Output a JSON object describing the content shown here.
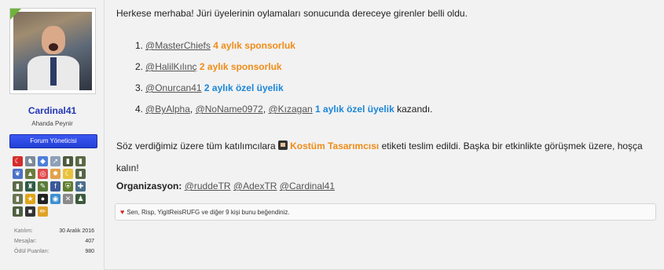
{
  "sidebar": {
    "username": "Cardinal41",
    "user_title": "Ahanda Peynir",
    "role_banner": "Forum Yöneticisi",
    "trophies": [
      {
        "icon": "flag-icon",
        "glyph": "☾",
        "color": "#d52b2b"
      },
      {
        "icon": "trophy-scene-icon",
        "glyph": "♞",
        "color": "#7c8a99"
      },
      {
        "icon": "pill-icon",
        "glyph": "◆",
        "color": "#4f7fd9"
      },
      {
        "icon": "rocket-icon",
        "glyph": "➚",
        "color": "#8da0b8"
      },
      {
        "icon": "rank-badge-icon",
        "glyph": "▮",
        "color": "#4e5a3c"
      },
      {
        "icon": "rank-badge-icon",
        "glyph": "▮",
        "color": "#5a6a44"
      },
      {
        "icon": "laurel-icon",
        "glyph": "❦",
        "color": "#4b72c8"
      },
      {
        "icon": "tank-icon",
        "glyph": "▲",
        "color": "#6b7b3f"
      },
      {
        "icon": "target-icon",
        "glyph": "◎",
        "color": "#e14b4b"
      },
      {
        "icon": "gear-icon",
        "glyph": "✹",
        "color": "#e2a14a"
      },
      {
        "icon": "moon-icon",
        "glyph": "☾",
        "color": "#e8c23a"
      },
      {
        "icon": "rank-badge-icon",
        "glyph": "▮",
        "color": "#556545"
      },
      {
        "icon": "rank-badge-icon",
        "glyph": "▮",
        "color": "#5b6a48"
      },
      {
        "icon": "soldier-icon",
        "glyph": "♜",
        "color": "#2e5a44"
      },
      {
        "icon": "knife-icon",
        "glyph": "✎",
        "color": "#5a7a3a"
      },
      {
        "icon": "facebook-icon",
        "glyph": "f",
        "color": "#3b5998"
      },
      {
        "icon": "shield-icon",
        "glyph": "⛨",
        "color": "#5f7d2e"
      },
      {
        "icon": "ribbon-icon",
        "glyph": "✚",
        "color": "#4a6e8a"
      },
      {
        "icon": "rank-badge-icon",
        "glyph": "▮",
        "color": "#6a7552"
      },
      {
        "icon": "star-icon",
        "glyph": "★",
        "color": "#e2a518"
      },
      {
        "icon": "bomb-icon",
        "glyph": "●",
        "color": "#222222"
      },
      {
        "icon": "globe-icon",
        "glyph": "◉",
        "color": "#3c8fd0"
      },
      {
        "icon": "crossed-swords-icon",
        "glyph": "✕",
        "color": "#8a8a8a"
      },
      {
        "icon": "soldier-icon",
        "glyph": "♟",
        "color": "#3c5a3c"
      },
      {
        "icon": "award-icon",
        "glyph": "▮",
        "color": "#4e6040"
      },
      {
        "icon": "costume-icon",
        "glyph": "■",
        "color": "#333333"
      },
      {
        "icon": "pencil-icon",
        "glyph": "✏",
        "color": "#e0a22a"
      }
    ],
    "stats": [
      {
        "label": "Katılım:",
        "value": "30 Aralık 2016"
      },
      {
        "label": "Mesajlar:",
        "value": "407"
      },
      {
        "label": "Ödül Puanları:",
        "value": "980"
      }
    ]
  },
  "post": {
    "intro": "Herkese merhaba! Jüri üyelerinin oylamaları sonucunda dereceye girenler belli oldu.",
    "winners": [
      {
        "num": "1.",
        "mentions": [
          "@MasterChiefs"
        ],
        "prize": "4 aylık sponsorluk",
        "prize_color": "orange",
        "suffix": ""
      },
      {
        "num": "2.",
        "mentions": [
          "@HalilKılınç"
        ],
        "prize": "2 aylık sponsorluk",
        "prize_color": "orange",
        "suffix": ""
      },
      {
        "num": "3.",
        "mentions": [
          "@Onurcan41"
        ],
        "prize": "2 aylık özel üyelik",
        "prize_color": "blue",
        "suffix": ""
      },
      {
        "num": "4.",
        "mentions": [
          "@ByAlpha",
          "@NoName0972",
          "@Kızagan"
        ],
        "prize": "1 aylık özel üyelik",
        "prize_color": "blue",
        "suffix": "kazandı."
      }
    ],
    "para_before": "Söz verdiğimiz üzere tüm katılımcılara",
    "costume_label": "Kostüm Tasarımcısı",
    "para_after": "etiketi teslim edildi. Başka bir etkinlikte görüşmek üzere, hoşça kalın!",
    "organizers_label": "Organizasyon:",
    "organizers": [
      "@ruddeTR",
      "@AdexTR",
      "@Cardinal41"
    ]
  },
  "likes": {
    "text": "Sen, Risp, YigitReisRUFG ve diğer 9 kişi bunu beğendiniz."
  },
  "colors": {
    "username": "#2437b7",
    "role_banner": "#2d49e6",
    "prize_orange": "#f08c18",
    "prize_blue": "#1c86d8",
    "heart": "#d9262b"
  }
}
